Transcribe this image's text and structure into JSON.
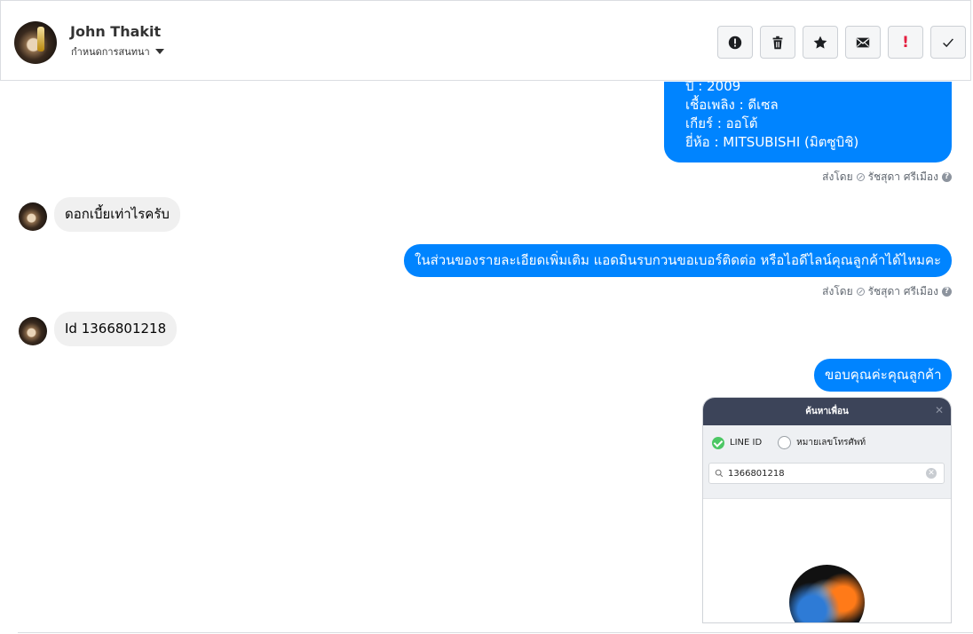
{
  "header": {
    "contact_name": "John Thakit",
    "subtitle": "กำหนดการสนทนา"
  },
  "toolbar": {
    "buttons": [
      "report-icon",
      "trash-icon",
      "star-icon",
      "mail-icon",
      "exclamation-icon",
      "check-icon"
    ],
    "exclamation_label": "!"
  },
  "messages": {
    "car_info": {
      "line_year": "ปี : 2009",
      "line_fuel": "เชื้อเพลิง : ดีเซล",
      "line_gear": "เกียร์ : ออโต้",
      "line_brand": "ยี่ห้อ : MITSUBISHI (มิตซูบิชิ)"
    },
    "sent_by_1": "ส่งโดย",
    "agent_1": "รัชสุดา ศรีเมือง",
    "incoming_1": "ดอกเบี้ยเท่าไรครับ",
    "outgoing_1": "ในส่วนของรายละเอียดเพิ่มเติม แอดมินรบกวนขอเบอร์ติดต่อ หรือไอดีไลน์คุณลูกค้าได้ไหมคะ",
    "sent_by_2": "ส่งโดย",
    "agent_2": "รัชสุดา ศรีเมือง",
    "incoming_2": "Id 1366801218",
    "outgoing_2": "ขอบคุณค่ะคุณลูกค้า"
  },
  "line_screenshot": {
    "title": "ค้นหาเพื่อน",
    "option_line_id": "LINE ID",
    "option_phone": "หมายเลขโทรศัพท์",
    "search_value": "1366801218"
  },
  "colors": {
    "outgoing_bubble": "#0084ff",
    "incoming_bubble": "#f0f0f0",
    "line_green": "#4cc764",
    "line_header": "#3c4459"
  }
}
